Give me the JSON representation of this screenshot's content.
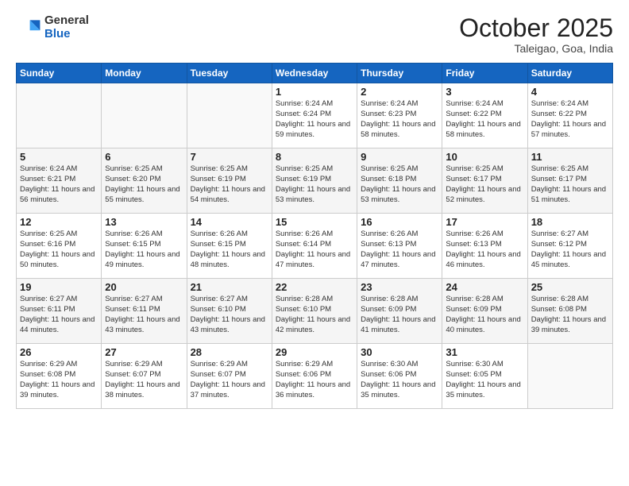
{
  "header": {
    "logo_general": "General",
    "logo_blue": "Blue",
    "month_title": "October 2025",
    "subtitle": "Taleigao, Goa, India"
  },
  "days_of_week": [
    "Sunday",
    "Monday",
    "Tuesday",
    "Wednesday",
    "Thursday",
    "Friday",
    "Saturday"
  ],
  "weeks": [
    [
      {
        "day": "",
        "info": ""
      },
      {
        "day": "",
        "info": ""
      },
      {
        "day": "",
        "info": ""
      },
      {
        "day": "1",
        "info": "Sunrise: 6:24 AM\nSunset: 6:24 PM\nDaylight: 11 hours\nand 59 minutes."
      },
      {
        "day": "2",
        "info": "Sunrise: 6:24 AM\nSunset: 6:23 PM\nDaylight: 11 hours\nand 58 minutes."
      },
      {
        "day": "3",
        "info": "Sunrise: 6:24 AM\nSunset: 6:22 PM\nDaylight: 11 hours\nand 58 minutes."
      },
      {
        "day": "4",
        "info": "Sunrise: 6:24 AM\nSunset: 6:22 PM\nDaylight: 11 hours\nand 57 minutes."
      }
    ],
    [
      {
        "day": "5",
        "info": "Sunrise: 6:24 AM\nSunset: 6:21 PM\nDaylight: 11 hours\nand 56 minutes."
      },
      {
        "day": "6",
        "info": "Sunrise: 6:25 AM\nSunset: 6:20 PM\nDaylight: 11 hours\nand 55 minutes."
      },
      {
        "day": "7",
        "info": "Sunrise: 6:25 AM\nSunset: 6:19 PM\nDaylight: 11 hours\nand 54 minutes."
      },
      {
        "day": "8",
        "info": "Sunrise: 6:25 AM\nSunset: 6:19 PM\nDaylight: 11 hours\nand 53 minutes."
      },
      {
        "day": "9",
        "info": "Sunrise: 6:25 AM\nSunset: 6:18 PM\nDaylight: 11 hours\nand 53 minutes."
      },
      {
        "day": "10",
        "info": "Sunrise: 6:25 AM\nSunset: 6:17 PM\nDaylight: 11 hours\nand 52 minutes."
      },
      {
        "day": "11",
        "info": "Sunrise: 6:25 AM\nSunset: 6:17 PM\nDaylight: 11 hours\nand 51 minutes."
      }
    ],
    [
      {
        "day": "12",
        "info": "Sunrise: 6:25 AM\nSunset: 6:16 PM\nDaylight: 11 hours\nand 50 minutes."
      },
      {
        "day": "13",
        "info": "Sunrise: 6:26 AM\nSunset: 6:15 PM\nDaylight: 11 hours\nand 49 minutes."
      },
      {
        "day": "14",
        "info": "Sunrise: 6:26 AM\nSunset: 6:15 PM\nDaylight: 11 hours\nand 48 minutes."
      },
      {
        "day": "15",
        "info": "Sunrise: 6:26 AM\nSunset: 6:14 PM\nDaylight: 11 hours\nand 47 minutes."
      },
      {
        "day": "16",
        "info": "Sunrise: 6:26 AM\nSunset: 6:13 PM\nDaylight: 11 hours\nand 47 minutes."
      },
      {
        "day": "17",
        "info": "Sunrise: 6:26 AM\nSunset: 6:13 PM\nDaylight: 11 hours\nand 46 minutes."
      },
      {
        "day": "18",
        "info": "Sunrise: 6:27 AM\nSunset: 6:12 PM\nDaylight: 11 hours\nand 45 minutes."
      }
    ],
    [
      {
        "day": "19",
        "info": "Sunrise: 6:27 AM\nSunset: 6:11 PM\nDaylight: 11 hours\nand 44 minutes."
      },
      {
        "day": "20",
        "info": "Sunrise: 6:27 AM\nSunset: 6:11 PM\nDaylight: 11 hours\nand 43 minutes."
      },
      {
        "day": "21",
        "info": "Sunrise: 6:27 AM\nSunset: 6:10 PM\nDaylight: 11 hours\nand 43 minutes."
      },
      {
        "day": "22",
        "info": "Sunrise: 6:28 AM\nSunset: 6:10 PM\nDaylight: 11 hours\nand 42 minutes."
      },
      {
        "day": "23",
        "info": "Sunrise: 6:28 AM\nSunset: 6:09 PM\nDaylight: 11 hours\nand 41 minutes."
      },
      {
        "day": "24",
        "info": "Sunrise: 6:28 AM\nSunset: 6:09 PM\nDaylight: 11 hours\nand 40 minutes."
      },
      {
        "day": "25",
        "info": "Sunrise: 6:28 AM\nSunset: 6:08 PM\nDaylight: 11 hours\nand 39 minutes."
      }
    ],
    [
      {
        "day": "26",
        "info": "Sunrise: 6:29 AM\nSunset: 6:08 PM\nDaylight: 11 hours\nand 39 minutes."
      },
      {
        "day": "27",
        "info": "Sunrise: 6:29 AM\nSunset: 6:07 PM\nDaylight: 11 hours\nand 38 minutes."
      },
      {
        "day": "28",
        "info": "Sunrise: 6:29 AM\nSunset: 6:07 PM\nDaylight: 11 hours\nand 37 minutes."
      },
      {
        "day": "29",
        "info": "Sunrise: 6:29 AM\nSunset: 6:06 PM\nDaylight: 11 hours\nand 36 minutes."
      },
      {
        "day": "30",
        "info": "Sunrise: 6:30 AM\nSunset: 6:06 PM\nDaylight: 11 hours\nand 35 minutes."
      },
      {
        "day": "31",
        "info": "Sunrise: 6:30 AM\nSunset: 6:05 PM\nDaylight: 11 hours\nand 35 minutes."
      },
      {
        "day": "",
        "info": ""
      }
    ]
  ]
}
